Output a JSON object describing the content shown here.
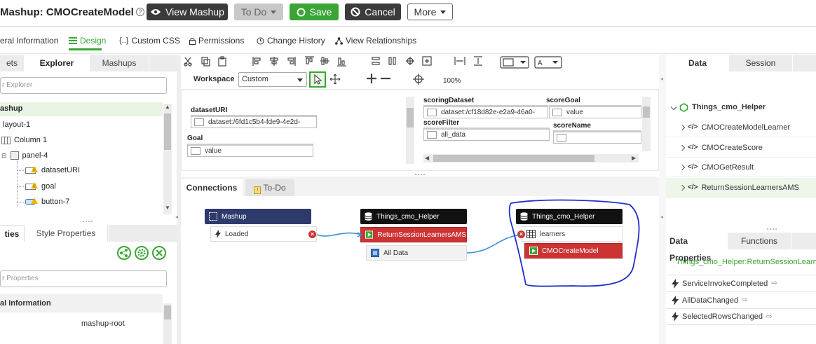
{
  "header": {
    "title": "Mashup: CMOCreateModel",
    "view_mashup": "View Mashup",
    "todo": "To Do",
    "save": "Save",
    "cancel": "Cancel",
    "more": "More"
  },
  "nav_tabs": {
    "general": "eral Information",
    "design": "Design",
    "custom_css": "Custom CSS",
    "permissions": "Permissions",
    "change_history": "Change History",
    "view_relationships": "View Relationships"
  },
  "left_panel": {
    "tabs": [
      "ets",
      "Explorer",
      "Mashups"
    ],
    "search_placeholder": "r Explorer",
    "tree": {
      "root": "ashup",
      "layout": "layout-1",
      "column": "Column 1",
      "panel": "panel-4",
      "datasetURI": "datasetURI",
      "goal": "goal",
      "button": "button-7"
    },
    "props_tabs": [
      "ties",
      "Style Properties"
    ],
    "props_search_placeholder": "r Properties",
    "props_section": "al Information",
    "props_value": "mashup-root"
  },
  "workspace": {
    "label": "Workspace",
    "mode": "Custom",
    "zoom": "100%"
  },
  "canvas": {
    "datasetURI_label": "datasetURI",
    "datasetURI_value": "dataset:/6fd1c5b4-fde9-4e2d-",
    "goal_label": "Goal",
    "goal_value": "value",
    "scoringDataset_label": "scoringDataset",
    "scoringDataset_value": "dataset:/cf18d82e-e2a9-46a0-",
    "scoreGoal_label": "scoreGoal",
    "scoreGoal_value": "value",
    "scoreFilter_label": "scoreFilter",
    "scoreFilter_value": "all_data",
    "scoreName_label": "scoreName"
  },
  "connections": {
    "tab_connections": "Connections",
    "tab_todo": "To-Do",
    "mashup_node": "Mashup",
    "loaded_event": "Loaded",
    "helper_node_1": "Things_cmo_Helper",
    "service_1": "ReturnSessionLearnersAMS",
    "all_data": "All Data",
    "helper_node_2": "Things_cmo_Helper",
    "learners_param": "learners",
    "service_2": "CMOCreateModel"
  },
  "right_panel": {
    "tabs": [
      "Data",
      "Session"
    ],
    "thing": "Things_cmo_Helper",
    "services": [
      "CMOCreateModelLearner",
      "CMOCreateScore",
      "CMOGetResult",
      "ReturnSessionLearnersAMS"
    ],
    "bottom_tabs": [
      "Data Properties",
      "Functions"
    ],
    "selected_service": "Things_cmo_Helper:ReturnSessionLearne",
    "events": [
      "ServiceInvokeCompleted",
      "AllDataChanged",
      "SelectedRowsChanged"
    ]
  },
  "colors": {
    "accent_green": "#3aa535",
    "node_navy": "#2e3a6b",
    "node_black": "#111111",
    "service_red": "#c33333",
    "annotation_blue": "#1f2fc8",
    "link_blue": "#3a8fd8"
  }
}
